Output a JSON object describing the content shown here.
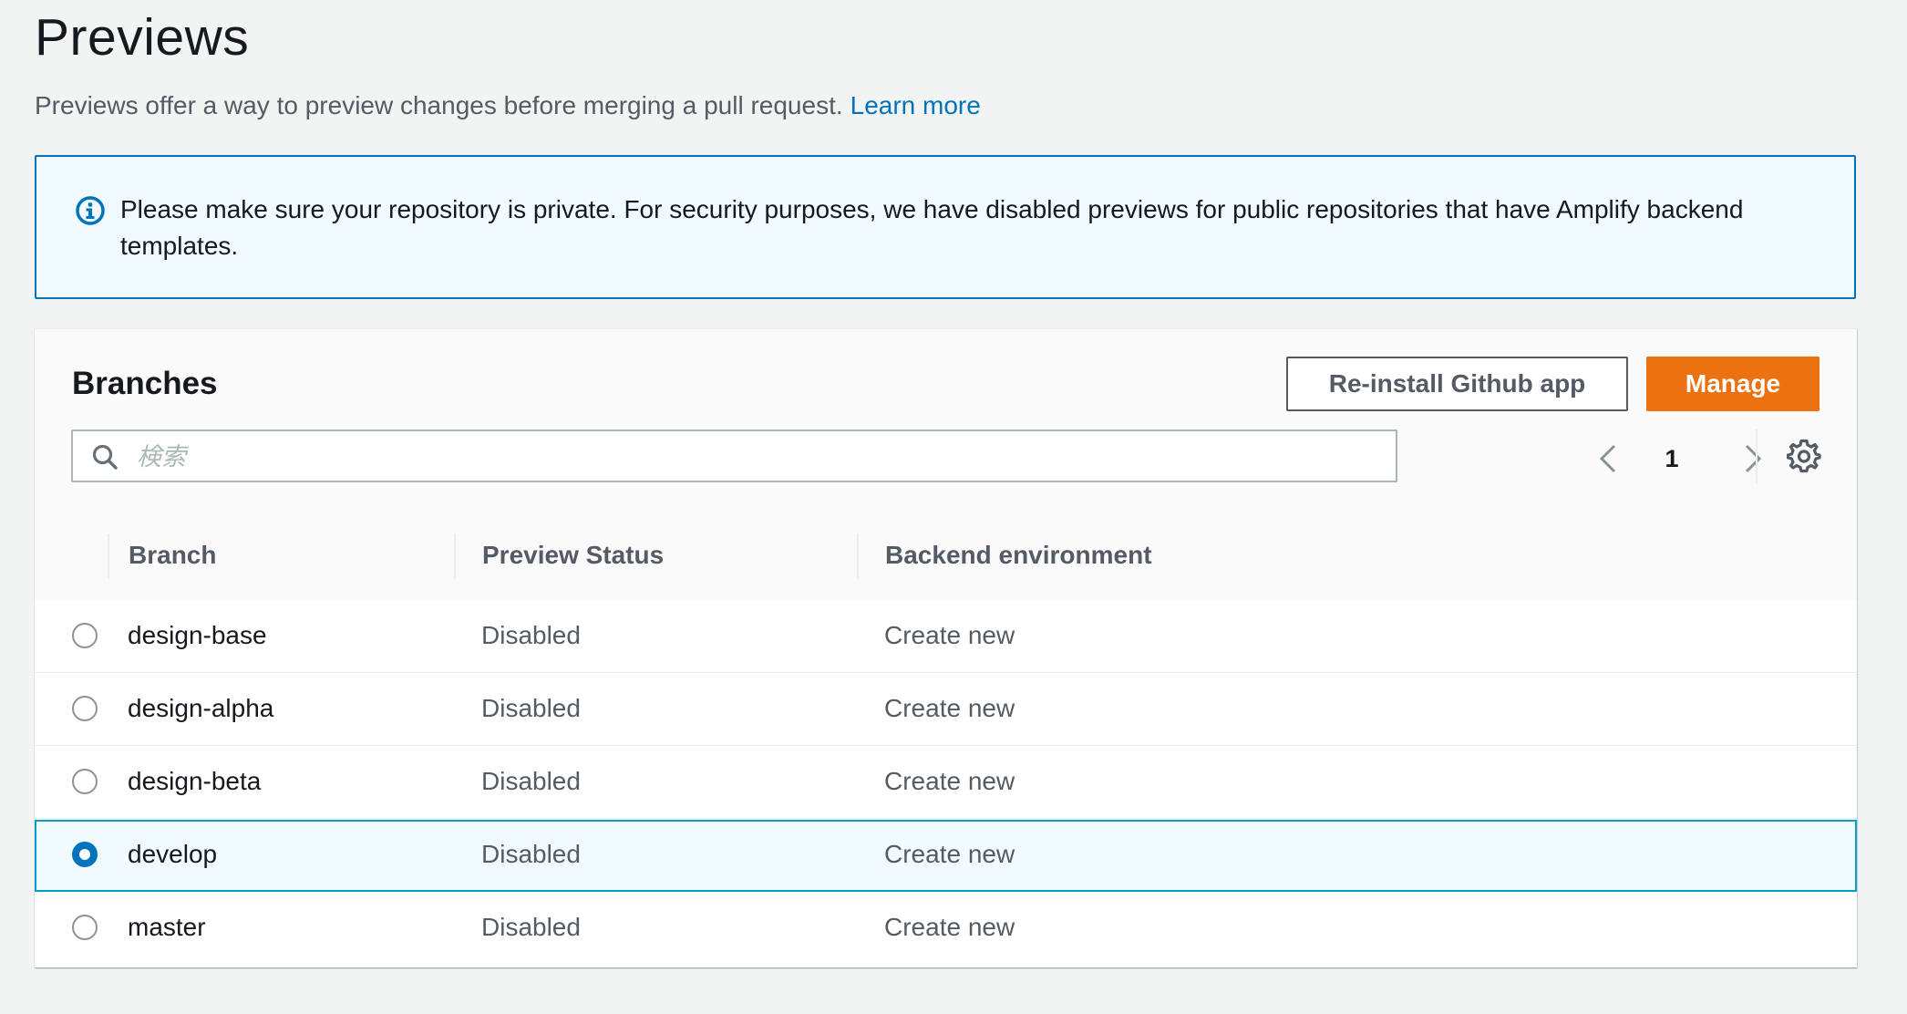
{
  "page": {
    "title": "Previews",
    "description": "Previews offer a way to preview changes before merging a pull request.",
    "learn_more": "Learn more"
  },
  "alert": {
    "icon": "info-icon",
    "text": "Please make sure your repository is private. For security purposes, we have disabled previews for public repositories that have Amplify backend templates."
  },
  "branches_panel": {
    "title": "Branches",
    "reinstall_label": "Re-install Github app",
    "manage_label": "Manage",
    "search_placeholder": "検索",
    "search_value": "",
    "current_page": "1",
    "columns": {
      "branch": "Branch",
      "preview_status": "Preview Status",
      "backend_environment": "Backend environment"
    },
    "rows": [
      {
        "branch": "design-base",
        "status": "Disabled",
        "backend": "Create new",
        "selected": false
      },
      {
        "branch": "design-alpha",
        "status": "Disabled",
        "backend": "Create new",
        "selected": false
      },
      {
        "branch": "design-beta",
        "status": "Disabled",
        "backend": "Create new",
        "selected": false
      },
      {
        "branch": "develop",
        "status": "Disabled",
        "backend": "Create new",
        "selected": true
      },
      {
        "branch": "master",
        "status": "Disabled",
        "backend": "Create new",
        "selected": false
      }
    ]
  },
  "colors": {
    "primary_button": "#ec7211",
    "link": "#0073bb",
    "selected_row_bg": "#f1faff",
    "selected_row_border": "#00a1c9",
    "alert_border": "#0073bb"
  }
}
